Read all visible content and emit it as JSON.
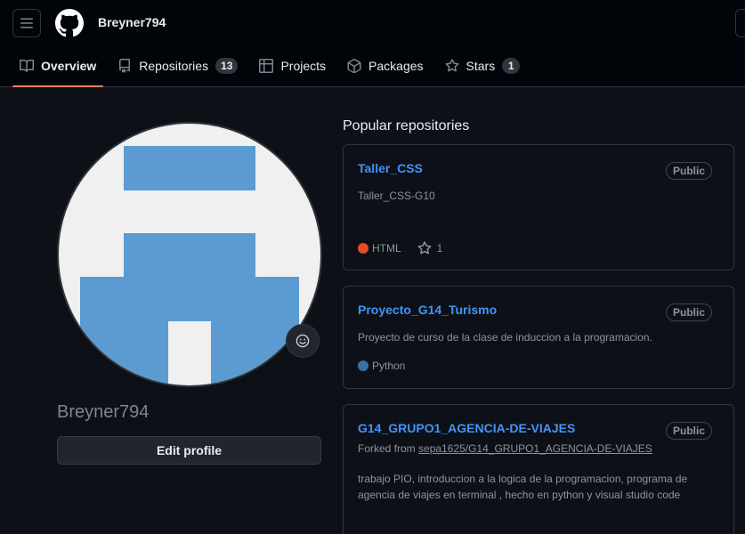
{
  "header": {
    "username": "Breyner794"
  },
  "tabs": [
    {
      "label": "Overview",
      "active": true,
      "icon": "book-icon"
    },
    {
      "label": "Repositories",
      "count": "13",
      "icon": "repo-icon"
    },
    {
      "label": "Projects",
      "icon": "table-icon"
    },
    {
      "label": "Packages",
      "icon": "package-icon"
    },
    {
      "label": "Stars",
      "count": "1",
      "icon": "star-icon"
    }
  ],
  "profile": {
    "name": "Breyner794",
    "edit_label": "Edit profile"
  },
  "popular": {
    "title": "Popular repositories",
    "repos": [
      {
        "name": "Taller_CSS",
        "visibility": "Public",
        "description": "Taller_CSS-G10",
        "language": "HTML",
        "language_color": "#e34c26",
        "stars": "1"
      },
      {
        "name": "Proyecto_G14_Turismo",
        "visibility": "Public",
        "description": "Proyecto de curso de la clase de induccion a la programacion.",
        "language": "Python",
        "language_color": "#3572A5"
      },
      {
        "name": "G14_GRUPO1_AGENCIA-DE-VIAJES",
        "visibility": "Public",
        "forked_prefix": "Forked from",
        "forked_from": "sepa1625/G14_GRUPO1_AGENCIA-DE-VIAJES",
        "description": "trabajo PIO, introduccion a la logica de la programacion, programa de agencia de viajes en terminal , hecho en python y visual studio code"
      }
    ]
  },
  "colors": {
    "background": "#0d1117",
    "accent_underline": "#f78166",
    "link": "#4493f8",
    "avatar_blue": "#5b9bd1"
  }
}
